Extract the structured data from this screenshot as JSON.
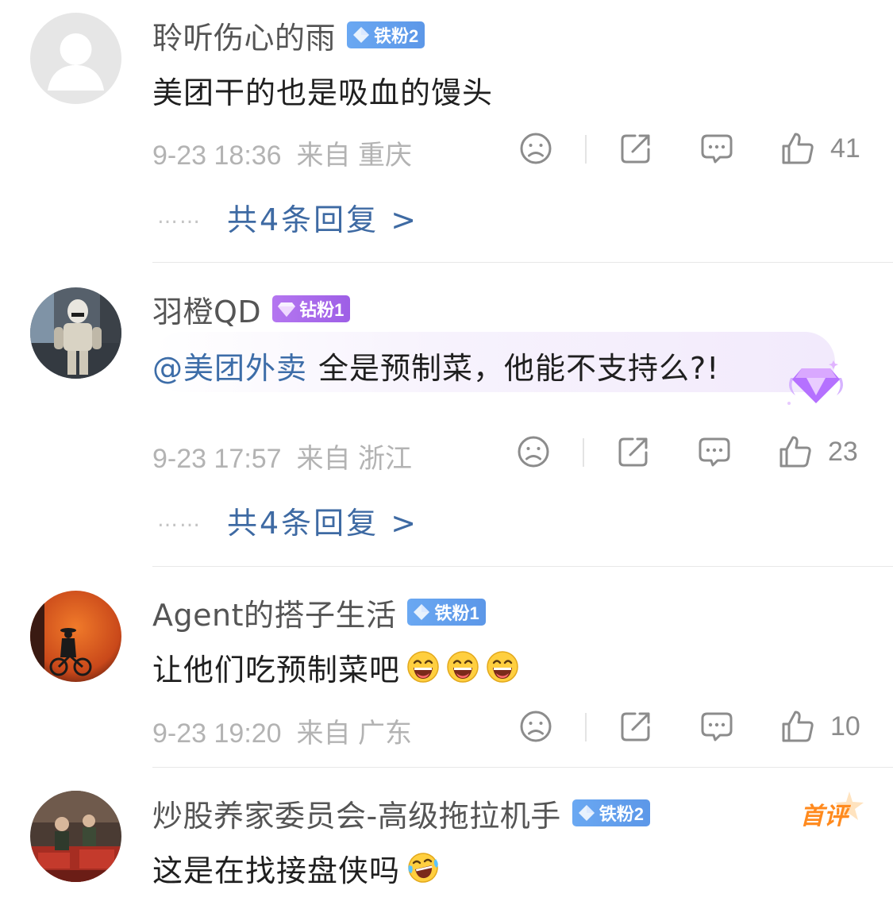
{
  "comments": [
    {
      "username": "聆听伤心的雨",
      "badge": "铁粉2",
      "badge_type": "iron",
      "text": "美团干的也是吸血的馒头",
      "time": "9-23 18:36",
      "location": "来自 重庆",
      "likes": "41",
      "reply_link": "共4条回复 >"
    },
    {
      "username": "羽橙QD",
      "badge": "钻粉1",
      "badge_type": "diamond",
      "mention": "@美团外卖",
      "text": "全是预制菜，他能不支持么?!",
      "time": "9-23 17:57",
      "location": "来自 浙江",
      "likes": "23",
      "reply_link": "共4条回复 >"
    },
    {
      "username": "Agent的搭子生活",
      "badge": "铁粉1",
      "badge_type": "iron",
      "text": "让他们吃预制菜吧",
      "emojis": [
        "laughing-emoji",
        "laughing-emoji",
        "laughing-emoji"
      ],
      "time": "9-23 19:20",
      "location": "来自 广东",
      "likes": "10"
    },
    {
      "username": "炒股养家委员会-高级拖拉机手",
      "badge": "铁粉2",
      "badge_type": "iron",
      "tag": "首评",
      "text": "这是在找接盘侠吗",
      "emojis": [
        "crying-laughing-emoji"
      ]
    }
  ],
  "dots": "……",
  "colors": {
    "username": "#555555",
    "meta": "#b3b3b3",
    "link": "#3e6aa3",
    "iron_badge": "#6aa8f2",
    "diamond_badge": "#b476f0",
    "first_tag": "#ff8a1e"
  },
  "icons": [
    "dislike-icon",
    "share-icon",
    "comment-icon",
    "like-icon"
  ]
}
